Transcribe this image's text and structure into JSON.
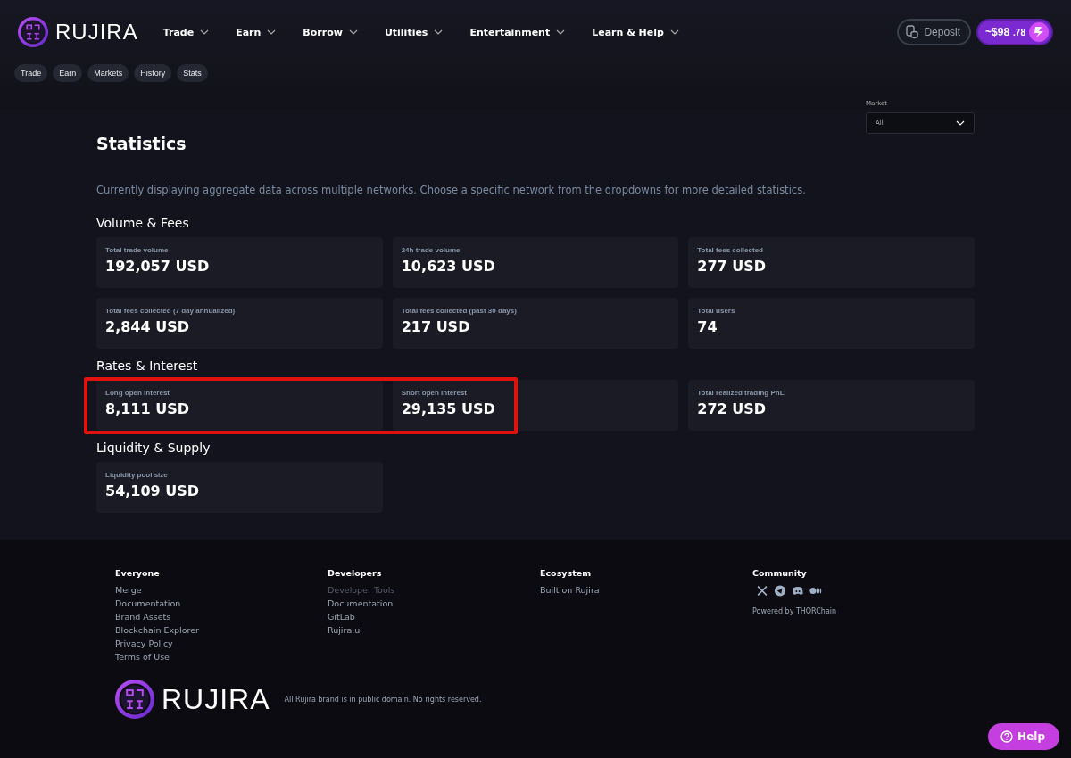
{
  "brand": "RUJIRA",
  "nav": [
    {
      "label": "Trade"
    },
    {
      "label": "Earn"
    },
    {
      "label": "Borrow"
    },
    {
      "label": "Utilities"
    },
    {
      "label": "Entertainment"
    },
    {
      "label": "Learn & Help"
    }
  ],
  "deposit": "Deposit",
  "balance": {
    "main": "~$98",
    "cents": ".78"
  },
  "subnav": [
    "Trade",
    "Earn",
    "Markets",
    "History",
    "Stats"
  ],
  "page_title": "Statistics",
  "market_filter": {
    "label": "Market",
    "value": "All"
  },
  "notice": "Currently displaying aggregate data across multiple networks. Choose a specific network from the dropdowns for more detailed statistics.",
  "sections": [
    {
      "title": "Volume & Fees",
      "highlight": false,
      "cards": [
        {
          "label": "Total trade volume",
          "value": "192,057 USD"
        },
        {
          "label": "24h trade volume",
          "value": "10,623 USD"
        },
        {
          "label": "Total fees collected",
          "value": "277 USD"
        },
        {
          "label": "Total fees collected (7 day annualized)",
          "value": "2,844 USD"
        },
        {
          "label": "Total fees collected (past 30 days)",
          "value": "217 USD"
        },
        {
          "label": "Total users",
          "value": "74"
        }
      ]
    },
    {
      "title": "Rates & Interest",
      "highlight": true,
      "cards": [
        {
          "label": "Long open interest",
          "value": "8,111 USD"
        },
        {
          "label": "Short open interest",
          "value": "29,135 USD"
        },
        {
          "label": "Total realized trading PnL",
          "value": "272 USD"
        }
      ]
    },
    {
      "title": "Liquidity & Supply",
      "highlight": false,
      "cards": [
        {
          "label": "Liquidity pool size",
          "value": "54,109 USD"
        }
      ]
    }
  ],
  "footer": {
    "columns": [
      {
        "title": "Everyone",
        "links": [
          {
            "label": "Merge",
            "disabled": false
          },
          {
            "label": "Documentation",
            "disabled": false
          },
          {
            "label": "Brand Assets",
            "disabled": false
          },
          {
            "label": "Blockchain Explorer",
            "disabled": false
          },
          {
            "label": "Privacy Policy",
            "disabled": false
          },
          {
            "label": "Terms of Use",
            "disabled": false
          }
        ]
      },
      {
        "title": "Developers",
        "links": [
          {
            "label": "Developer Tools",
            "disabled": true
          },
          {
            "label": "Documentation",
            "disabled": false
          },
          {
            "label": "GitLab",
            "disabled": false
          },
          {
            "label": "Rujira.ui",
            "disabled": false
          }
        ]
      },
      {
        "title": "Ecosystem",
        "links": [
          {
            "label": "Built on Rujira",
            "disabled": false
          }
        ]
      }
    ],
    "community": {
      "title": "Community",
      "socials": [
        {
          "kind": "x"
        },
        {
          "kind": "telegram"
        },
        {
          "kind": "discord"
        },
        {
          "kind": "medium"
        }
      ],
      "powered": "Powered by THORChain"
    },
    "brand": "RUJIRA",
    "legal": "All Rujira brand is in public domain. No rights reserved."
  },
  "help": "Help"
}
